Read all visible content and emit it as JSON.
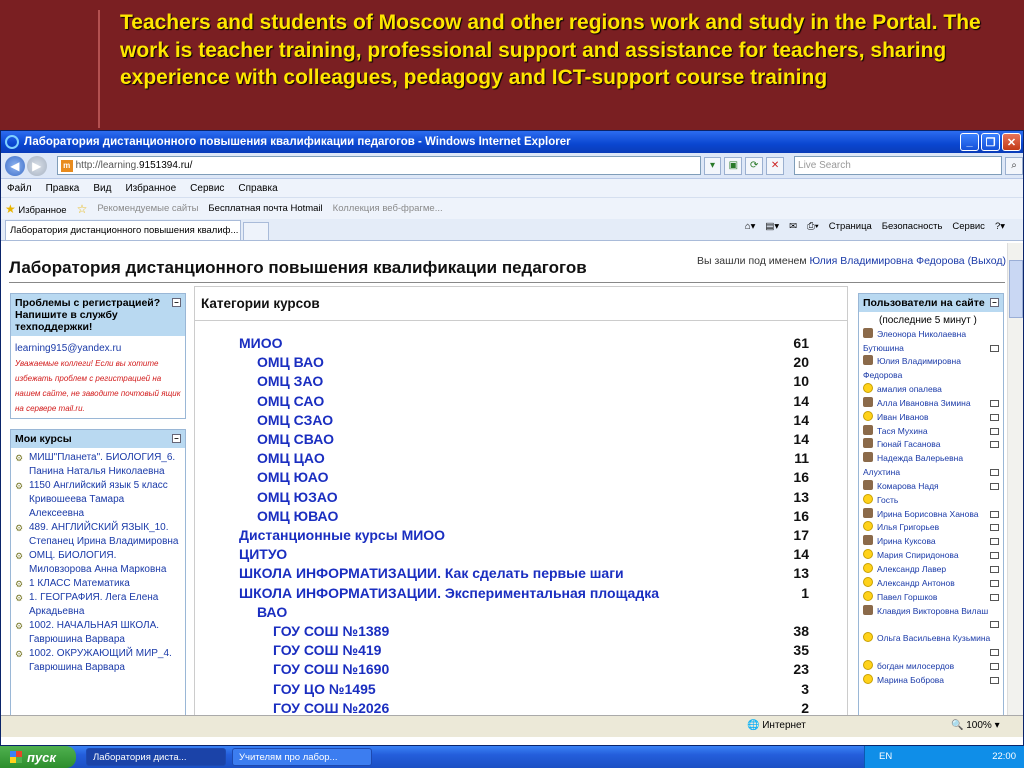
{
  "slide": {
    "heading": "Teachers and students of Moscow and other regions work and study in the Portal. The work is teacher training, professional support and assistance for teachers, sharing experience with colleagues, pedagogy and ICT-support course training"
  },
  "window": {
    "title": "Лаборатория дистанционного повышения квалификации педагогов - Windows Internet Explorer",
    "minimize": "_",
    "maximize": "❐",
    "close": "✕"
  },
  "address_bar": {
    "url_prefix": "http://learning.",
    "url_host": "9151394.ru/",
    "search_placeholder": "Live Search"
  },
  "menu": [
    "Файл",
    "Правка",
    "Вид",
    "Избранное",
    "Сервис",
    "Справка"
  ],
  "favorites_bar": {
    "favorites_label": "Избранное",
    "items": [
      {
        "label": "Рекомендуемые сайты",
        "muted": true
      },
      {
        "label": "Бесплатная почта Hotmail",
        "muted": false
      },
      {
        "label": "Коллекция веб-фрагме...",
        "muted": true
      }
    ]
  },
  "tab": {
    "label": "Лаборатория дистанционного повышения квалиф..."
  },
  "command_bar": [
    "Страница",
    "Безопасность",
    "Сервис"
  ],
  "site": {
    "title": "Лаборатория дистанционного повышения квалификации педагогов",
    "login_prefix": "Вы зашли под именем ",
    "login_user": "Юлия Владимировна Федорова",
    "logout": "(Выход)"
  },
  "support_block": {
    "heading": "Проблемы с регистрацией? Напишите в службу техподдержки!",
    "email": "learning915@yandex.ru",
    "warning": "Уважаемые коллеги! Если вы хотите избежать проблем с регистрацией на нашем сайте, не заводите почтовый ящик на сервере mail.ru."
  },
  "my_courses": {
    "heading": "Мои курсы",
    "items": [
      "МИШ\"Планета\". БИОЛОГИЯ_6. Панина Наталья Николаевна",
      "1150 Английский язык 5 класс Кривошеева Тамара Алексеевна",
      "489. АНГЛИЙСКИЙ ЯЗЫК_10. Степанец Ирина Владимировна",
      "ОМЦ. БИОЛОГИЯ. Миловзорова Анна Марковна",
      "1 КЛАСС Математика",
      "1. ГЕОГРАФИЯ. Лега Елена Аркадьевна",
      "1002. НАЧАЛЬНАЯ ШКОЛА. Гаврюшина Варвара",
      "1002. ОКРУЖАЮЩИЙ МИР_4. Гаврюшина Варвара"
    ]
  },
  "categories": {
    "heading": "Категории курсов",
    "rows": [
      {
        "name": "МИОО",
        "count": "61",
        "level": 0
      },
      {
        "name": "ОМЦ ВАО",
        "count": "20",
        "level": 1
      },
      {
        "name": "ОМЦ ЗАО",
        "count": "10",
        "level": 1
      },
      {
        "name": "ОМЦ САО",
        "count": "14",
        "level": 1
      },
      {
        "name": "ОМЦ СЗАО",
        "count": "14",
        "level": 1
      },
      {
        "name": "ОМЦ СВАО",
        "count": "14",
        "level": 1
      },
      {
        "name": "ОМЦ ЦАО",
        "count": "11",
        "level": 1
      },
      {
        "name": "ОМЦ ЮАО",
        "count": "16",
        "level": 1
      },
      {
        "name": "ОМЦ ЮЗАО",
        "count": "13",
        "level": 1
      },
      {
        "name": "ОМЦ ЮВАО",
        "count": "16",
        "level": 1
      },
      {
        "name": "Дистанционные курсы МИОО",
        "count": "17",
        "level": 0
      },
      {
        "name": "ЦИТУО",
        "count": "14",
        "level": 0
      },
      {
        "name": "ШКОЛА ИНФОРМАТИЗАЦИИ. Как сделать первые шаги",
        "count": "13",
        "level": 0
      },
      {
        "name": "ШКОЛА ИНФОРМАТИЗАЦИИ. Экспериментальная площадка",
        "count": "1",
        "level": 0
      },
      {
        "name": "ВАО",
        "count": "",
        "level": 1
      },
      {
        "name": "ГОУ СОШ №1389",
        "count": "38",
        "level": 2
      },
      {
        "name": "ГОУ СОШ №419",
        "count": "35",
        "level": 2
      },
      {
        "name": "ГОУ СОШ №1690",
        "count": "23",
        "level": 2
      },
      {
        "name": "ГОУ ЦО №1495",
        "count": "3",
        "level": 2
      },
      {
        "name": "ГОУ СОШ №2026",
        "count": "2",
        "level": 2
      }
    ]
  },
  "users_online": {
    "heading": "Пользователи на сайте",
    "subheading": "(последние 5 минут )",
    "users": [
      {
        "name": "Элеонора Николаевна Бутюшина",
        "smile": false,
        "mail": true,
        "lines": 2
      },
      {
        "name": "Юлия Владимировна Федорова",
        "smile": false,
        "mail": false,
        "lines": 2
      },
      {
        "name": "амалия опалева",
        "smile": true,
        "mail": false,
        "lines": 1
      },
      {
        "name": "Алла Ивановна Зимина",
        "smile": false,
        "mail": true,
        "lines": 1
      },
      {
        "name": "Иван Иванов",
        "smile": true,
        "mail": true,
        "lines": 1
      },
      {
        "name": "Тася Мухина",
        "smile": false,
        "mail": true,
        "lines": 1
      },
      {
        "name": "Гюнай Гасанова",
        "smile": false,
        "mail": true,
        "lines": 1
      },
      {
        "name": "Надежда Валерьевна Алухтина",
        "smile": false,
        "mail": true,
        "lines": 2
      },
      {
        "name": "Комарова Надя",
        "smile": false,
        "mail": true,
        "lines": 1
      },
      {
        "name": "Гость",
        "smile": true,
        "mail": false,
        "lines": 1
      },
      {
        "name": "Ирина Борисовна Ханова",
        "smile": false,
        "mail": true,
        "lines": 1
      },
      {
        "name": "Илья Григорьев",
        "smile": true,
        "mail": true,
        "lines": 1
      },
      {
        "name": "Ирина Куксова",
        "smile": false,
        "mail": true,
        "lines": 1
      },
      {
        "name": "Мария Спиридонова",
        "smile": true,
        "mail": true,
        "lines": 1
      },
      {
        "name": "Александр Лавер",
        "smile": true,
        "mail": true,
        "lines": 1
      },
      {
        "name": "Александр Антонов",
        "smile": true,
        "mail": true,
        "lines": 1
      },
      {
        "name": "Павел Горшков",
        "smile": true,
        "mail": true,
        "lines": 1
      },
      {
        "name": "Клавдия Викторовна Вилаш",
        "smile": false,
        "mail": true,
        "lines": 2
      },
      {
        "name": "Ольга Васильевна Кузьмина",
        "smile": true,
        "mail": true,
        "lines": 2
      },
      {
        "name": "богдан милосердов",
        "smile": true,
        "mail": true,
        "lines": 1
      },
      {
        "name": "Марина Боброва",
        "smile": true,
        "mail": true,
        "lines": 1
      }
    ]
  },
  "status_bar": {
    "zone": "Интернет",
    "zoom": "100%"
  },
  "taskbar": {
    "start": "пуск",
    "tasks": [
      "Лаборатория диста...",
      "Учителям про лабор..."
    ],
    "lang": "EN",
    "clock": "22:00"
  },
  "colors": {
    "slide_background": "#7a1f22",
    "slide_text": "#ffe600",
    "link": "#1a2ec0",
    "block_header": "#b9d9f1"
  }
}
